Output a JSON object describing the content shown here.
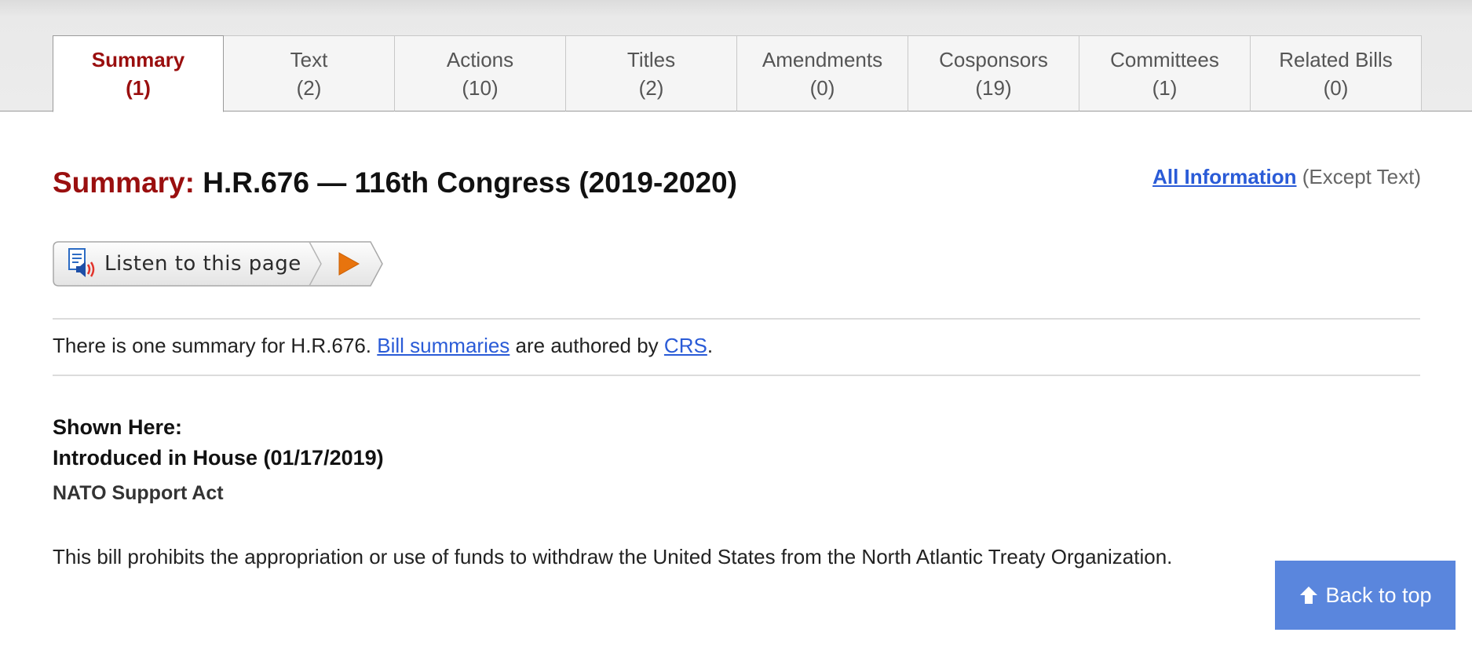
{
  "tabs": [
    {
      "name": "Summary",
      "count": "(1)"
    },
    {
      "name": "Text",
      "count": "(2)"
    },
    {
      "name": "Actions",
      "count": "(10)"
    },
    {
      "name": "Titles",
      "count": "(2)"
    },
    {
      "name": "Amendments",
      "count": "(0)"
    },
    {
      "name": "Cosponsors",
      "count": "(19)"
    },
    {
      "name": "Committees",
      "count": "(1)"
    },
    {
      "name": "Related Bills",
      "count": "(0)"
    }
  ],
  "header": {
    "label": "Summary:",
    "title": "H.R.676 — 116th Congress (2019-2020)",
    "all_info_link": "All Information",
    "all_info_suffix": "(Except Text)"
  },
  "listen": {
    "label": "Listen to this page",
    "icons": {
      "document": "document-speaker-icon",
      "play": "play-icon"
    },
    "colors": {
      "play": "#e8740e",
      "speaker": "#e2332b",
      "doc": "#2c6bc4"
    }
  },
  "summary_note": {
    "prefix": "There is one summary for H.R.676.",
    "link1": "Bill summaries",
    "middle": "are authored by",
    "link2": "CRS",
    "suffix": "."
  },
  "version": {
    "shown_here": "Shown Here:",
    "introduced": "Introduced in House (01/17/2019)",
    "act_name": "NATO Support Act",
    "text": "This bill prohibits the appropriation or use of funds to withdraw the United States from the North Atlantic Treaty Organization."
  },
  "back_to_top": {
    "label": "Back to top",
    "icon": "arrow-up-icon",
    "color": "#5a86dd"
  },
  "colors": {
    "accent": "#9a0f0f",
    "link": "#2a5bd7"
  }
}
